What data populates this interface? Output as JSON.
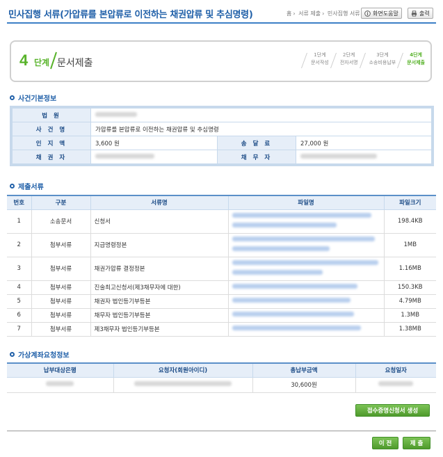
{
  "header": {
    "title": "민사집행 서류(가압류를 본압류로 이전하는 채권압류 및 추심명령)",
    "breadcrumb": [
      "홈",
      "서류 제출",
      "민사집행 서류"
    ],
    "help_label": "화면도움말",
    "print_label": "출력"
  },
  "step": {
    "number": "4",
    "unit": "단계",
    "name": "문서제출",
    "steps": [
      {
        "num": "1단계",
        "name": "문서작성"
      },
      {
        "num": "2단계",
        "name": "전자서명"
      },
      {
        "num": "3단계",
        "name": "소송비용납부"
      },
      {
        "num": "4단계",
        "name": "문서제출"
      }
    ]
  },
  "case_info": {
    "section_title": "사건기본정보",
    "labels": {
      "court": "법 원",
      "case_name": "사 건 명",
      "stamp": "인 지 액",
      "delivery": "송 달 료",
      "creditor": "채 권 자",
      "debtor": "채 무 자"
    },
    "case_name": "가압류를 본압류로 이전하는 채권압류 및 추심명령",
    "stamp_fee": "3,600 원",
    "delivery_fee": "27,000 원"
  },
  "documents": {
    "section_title": "제출서류",
    "columns": [
      "번호",
      "구분",
      "서류명",
      "파일명",
      "파일크기"
    ],
    "rows": [
      {
        "no": "1",
        "type": "소송문서",
        "name": "신청서",
        "size": "198.4KB"
      },
      {
        "no": "2",
        "type": "첨부서류",
        "name": "지급명령정본",
        "size": "1MB"
      },
      {
        "no": "3",
        "type": "첨부서류",
        "name": "채권가압류 결정정본",
        "size": "1.16MB"
      },
      {
        "no": "4",
        "type": "첨부서류",
        "name": "진술최고신청서(제3채무자에 대한)",
        "size": "150.3KB"
      },
      {
        "no": "5",
        "type": "첨부서류",
        "name": "채권자 법인등기부등본",
        "size": "4.79MB"
      },
      {
        "no": "6",
        "type": "첨부서류",
        "name": "채무자 법인등기부등본",
        "size": "1.3MB"
      },
      {
        "no": "7",
        "type": "첨부서류",
        "name": "제3채무자 법인등기부등본",
        "size": "1.38MB"
      }
    ]
  },
  "account": {
    "section_title": "가상계좌요청정보",
    "columns": [
      "납부대상은행",
      "요청자(회원아이디)",
      "총납부금액",
      "요청일자"
    ],
    "total": "30,600원"
  },
  "buttons": {
    "certificate": "접수증명신청서 생성",
    "prev": "이 전",
    "submit": "제 출"
  },
  "colors": {
    "title_blue": "#1f5fa8",
    "step_green": "#58b32a",
    "table_header_bg": "#e6eef8"
  }
}
